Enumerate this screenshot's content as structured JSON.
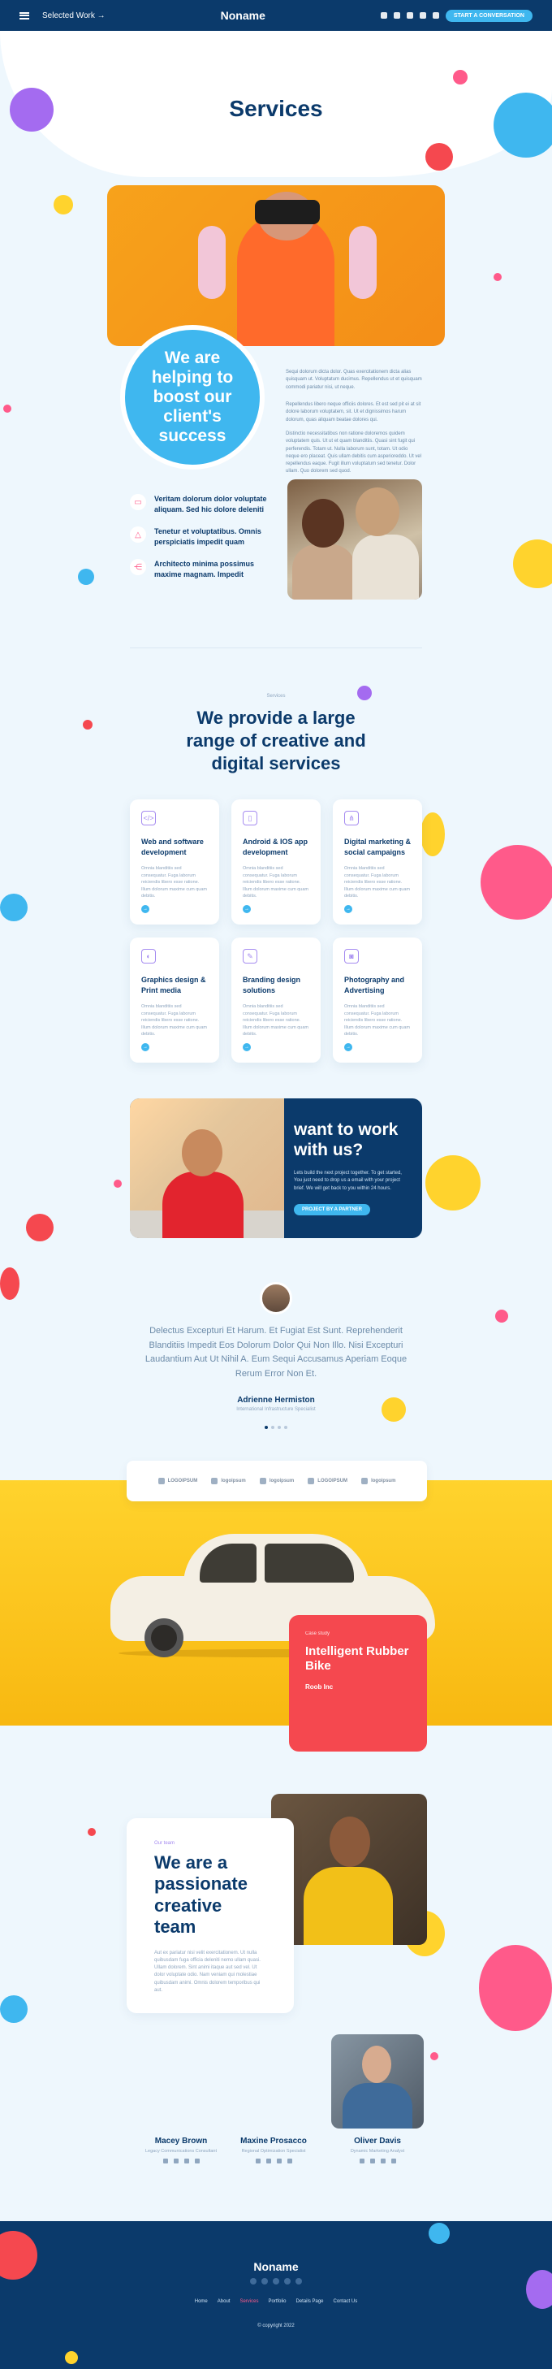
{
  "header": {
    "brand": "Noname",
    "menu_label": "Selected Work",
    "cta_label": "START A CONVERSATION",
    "social_icons": [
      "facebook-icon",
      "twitter-icon",
      "linkedin-icon",
      "youtube-icon",
      "dribbble-icon"
    ]
  },
  "hero": {
    "title": "Services",
    "bubble_text": "We are helping to boost our client's success",
    "paragraphs": [
      "Sequi dolorum dicta dolor. Quas exercitationem dicta alias quisquam ut. Voluptatum ducimus. Repellendus ut et quisquam commodi pariatur nisi, ut neque.",
      "Repellendus libero neque officiis dolores. Et est sed pit ei at sit dolore laborum voluptatem, sit. Ut et dignissimos harum dolorum, quas aliquam beatae dolores qui.",
      "Distinctio necessitatibus non ratione doloremos quidem voluptatem quis. Ut ut et quam blanditiis. Quasi sint fugit qui perferendis. Totam ut. Nulla laborum sunt, totam. Ut odio neque ero placeat. Quis ullam debitis cum asperioreddo. Ut vel repellendus eaque. Fugit illum voluptatum sed tenetur. Dolor ullam. Quo dolorem sed quod."
    ],
    "features": [
      {
        "icon": "monitor-icon",
        "text": "Veritam dolorum dolor voluptate aliquam. Sed hic dolore deleniti"
      },
      {
        "icon": "triangle-icon",
        "text": "Tenetur et voluptatibus. Omnis perspiciatis impedit quam"
      },
      {
        "icon": "share-icon",
        "text": "Architecto minima possimus maxime magnam. Impedit"
      }
    ]
  },
  "services": {
    "eyebrow": "Services",
    "heading_lines": [
      "We provide a large",
      "range of creative and",
      "digital services"
    ],
    "cards": [
      {
        "icon": "code-icon",
        "title": "Web and software development",
        "text": "Omnia blanditiis sed consequatur. Fuga laborum reiciendis libero esse ratione. Illum dolorum maxime cum quam debitis."
      },
      {
        "icon": "mobile-icon",
        "title": "Android & IOS app development",
        "text": "Omnia blanditiis sed consequatur. Fuga laborum reiciendis libero esse ratione. Illum dolorum maxime cum quam debitis."
      },
      {
        "icon": "network-icon",
        "title": "Digital marketing & social campaigns",
        "text": "Omnia blanditiis sed consequatur. Fuga laborum reiciendis libero esse ratione. Illum dolorum maxime cum quam debitis."
      },
      {
        "icon": "palette-icon",
        "title": "Graphics design & Print media",
        "text": "Omnia blanditiis sed consequatur. Fuga laborum reiciendis libero esse ratione. Illum dolorum maxime cum quam debitis."
      },
      {
        "icon": "brush-icon",
        "title": "Branding design solutions",
        "text": "Omnia blanditiis sed consequatur. Fuga laborum reiciendis libero esse ratione. Illum dolorum maxime cum quam debitis."
      },
      {
        "icon": "camera-icon",
        "title": "Photography and Advertising",
        "text": "Omnia blanditiis sed consequatur. Fuga laborum reiciendis libero esse ratione. Illum dolorum maxime cum quam debitis."
      }
    ]
  },
  "cta": {
    "heading": "want to work with us?",
    "text": "Lets build the next project together. To get started, You just need to drop us a email with your project brief. We will get back to you within 24 hours.",
    "button": "PROJECT BY A PARTNER"
  },
  "testimonial": {
    "quote": "Delectus Excepturi Et Harum. Et Fugiat Est Sunt. Reprehenderit Blanditiis Impedit Eos Dolorum Dolor Qui Non Illo. Nisi Excepturi Laudantium Aut Ut Nihil A. Eum Sequi Accusamus Aperiam Eoque Rerum Error Non Et.",
    "name": "Adrienne Hermiston",
    "role": "International Infrastructure Specialist"
  },
  "logos": [
    "LOGOIPSUM",
    "logoipsum",
    "logoipsum",
    "LOGOIPSUM",
    "logoipsum"
  ],
  "showcase": {
    "kicker": "Case study",
    "title": "Intelligent Rubber Bike",
    "subtitle": "Roob Inc"
  },
  "team": {
    "kicker": "Our team",
    "heading": "We are a passionate creative team",
    "text": "Aut ex pariatur nisi velit exercitationem. Ut nulla quibusdam fuga officia deleniti nemo ullam quasi. Ullam dolorem. Sint animi itaque aut sed vel. Ut dolor voluptate odio. Nam veniam qui molestiae quibusdam animi. Omnis dolorem temporibus qui aut.",
    "members": [
      {
        "name": "Macey Brown",
        "role": "Legacy Communications Consultant"
      },
      {
        "name": "Maxine Prosacco",
        "role": "Regional Optimization Specialist"
      },
      {
        "name": "Oliver Davis",
        "role": "Dynamic Marketing Analyst"
      }
    ]
  },
  "footer": {
    "brand": "Noname",
    "nav": [
      "Home",
      "About",
      "Services",
      "Portfolio",
      "Details Page",
      "Contact Us"
    ],
    "active_nav": "Services",
    "copyright": "© copyright 2022"
  },
  "colors": {
    "navy": "#0b3a6b",
    "sky": "#3fb7ef",
    "pink": "#ff5a8a",
    "purple": "#a58bf0",
    "yellow": "#ffd32d",
    "red": "#f5484f"
  }
}
